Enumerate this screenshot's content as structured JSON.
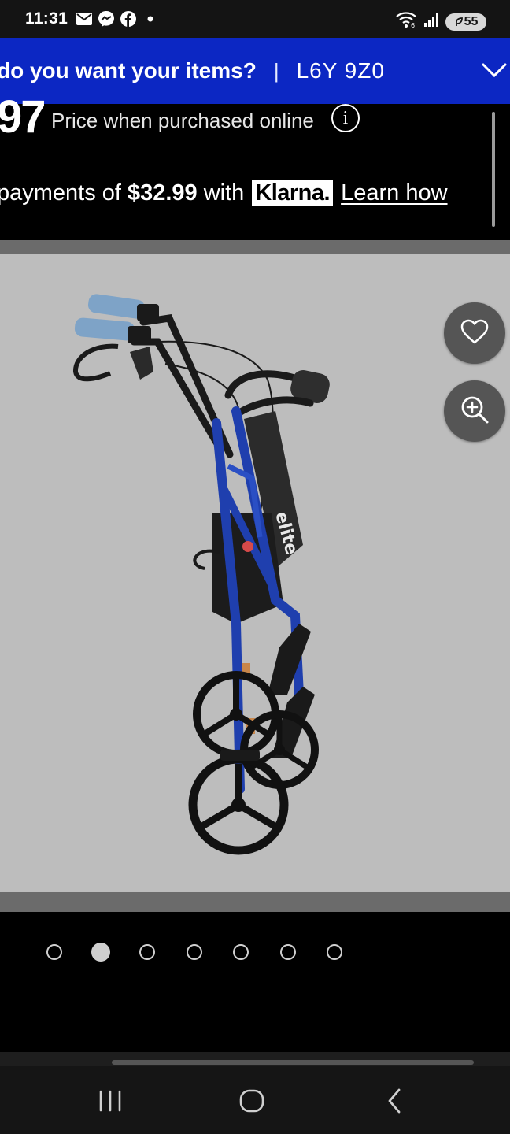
{
  "status_bar": {
    "time": "11:31",
    "notification_icons": [
      "mail-icon",
      "messenger-icon",
      "facebook-icon",
      "dot-icon"
    ],
    "signal_icons": [
      "wifi-icon",
      "cell-signal-icon"
    ],
    "battery": "55"
  },
  "location_bar": {
    "question": "do you want your items?",
    "separator": "|",
    "postal_code": "L6Y 9Z0"
  },
  "price": {
    "amount_fragment": "97",
    "note": "Price when purchased online",
    "info_icon_glyph": "i"
  },
  "klarna": {
    "prefix": "payments of",
    "amount": "$32.99",
    "with": "with",
    "logo": "Klarna.",
    "link": "Learn how"
  },
  "gallery": {
    "image_subject": "folded blue rollator walker with seat and basket",
    "buttons": [
      "heart-icon",
      "zoom-in-icon"
    ],
    "page_count": 7,
    "active_index": 1
  },
  "colors": {
    "brand_blue": "#0c27c3",
    "background": "#000000",
    "image_background": "#bdbdbd",
    "walker_blue": "#1f3fae"
  },
  "nav_bar": {
    "buttons": [
      "recent-apps-icon",
      "home-icon",
      "back-icon"
    ]
  }
}
